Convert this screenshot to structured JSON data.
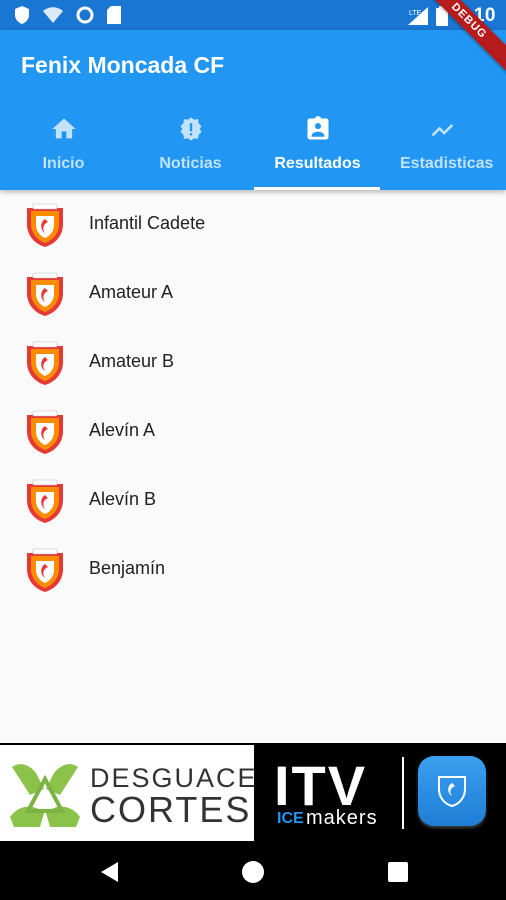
{
  "status_bar": {
    "time": "5:10",
    "network_label": "LTE",
    "icons": [
      "shield-icon",
      "wifi-icon",
      "sync-icon",
      "sd-card-icon",
      "signal-icon",
      "battery-icon"
    ]
  },
  "debug_banner": "DEBUG",
  "app_bar": {
    "title": "Fenix Moncada CF",
    "tabs": [
      {
        "label": "Inicio",
        "icon": "home-icon",
        "active": false
      },
      {
        "label": "Noticias",
        "icon": "alert-icon",
        "active": false
      },
      {
        "label": "Resultados",
        "icon": "assignment-icon",
        "active": true
      },
      {
        "label": "Estadisticas",
        "icon": "trending-up-icon",
        "active": false
      }
    ]
  },
  "teams": [
    {
      "label": "Infantil Cadete"
    },
    {
      "label": "Amateur A"
    },
    {
      "label": "Amateur B"
    },
    {
      "label": "Alevín A"
    },
    {
      "label": "Alevín B"
    },
    {
      "label": "Benjamín"
    }
  ],
  "ad_banner": {
    "left_brand_top": "DESGUACE",
    "left_brand_bottom": "CORTES",
    "right_brand": "ITV",
    "right_brand_sub_a": "ICE",
    "right_brand_sub_b": "makers"
  },
  "colors": {
    "primary": "#2196f3",
    "primary_dark": "#1976d2",
    "crest_red": "#e53935",
    "crest_orange": "#fb8c00"
  }
}
